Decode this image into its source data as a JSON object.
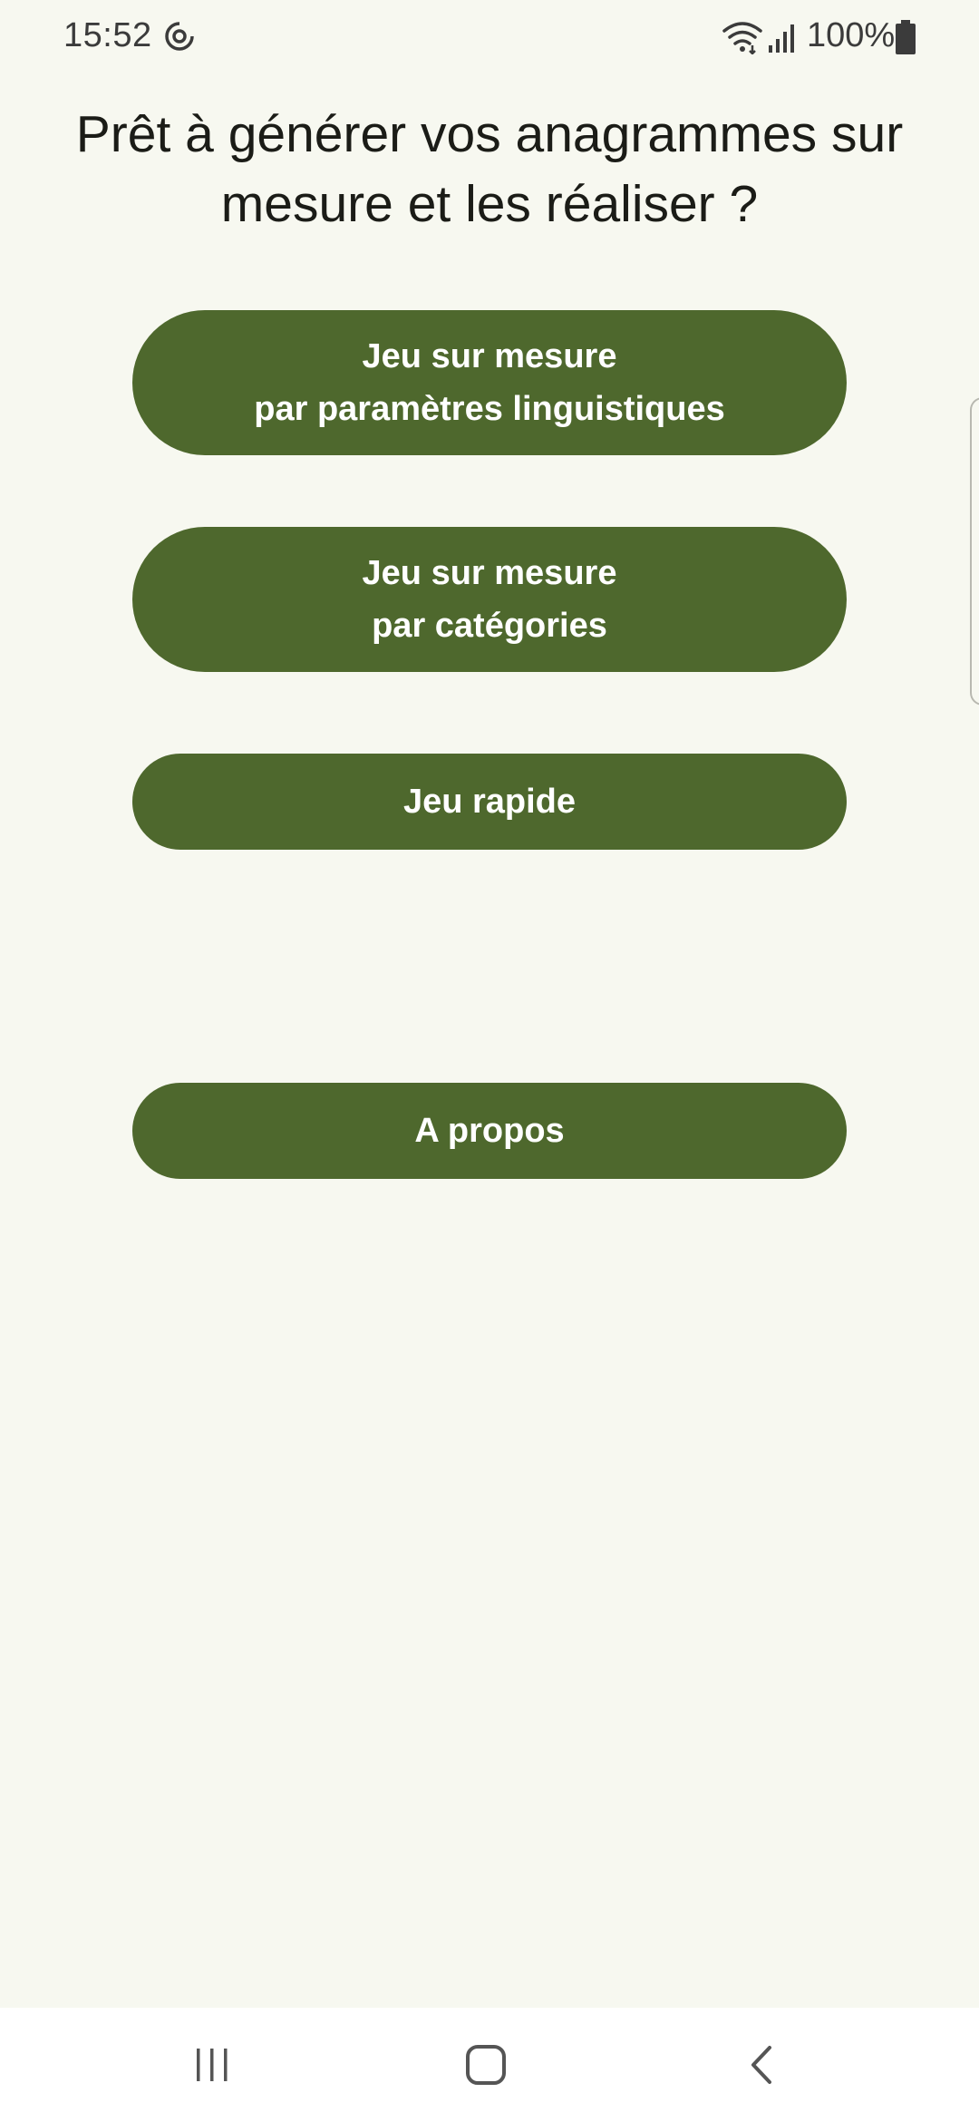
{
  "status_bar": {
    "time": "15:52",
    "battery_percent": "100%",
    "icons": [
      "app-notification-icon",
      "wifi-icon",
      "signal-icon",
      "battery-icon"
    ]
  },
  "main": {
    "headline": "Prêt à générer vos anagrammes sur\nmesure et les réaliser ?",
    "buttons": {
      "linguistic": "Jeu sur mesure\npar paramètres linguistiques",
      "categories": "Jeu sur mesure\npar catégories",
      "quick": "Jeu rapide",
      "about": "A propos"
    }
  },
  "nav_bar": {
    "icons": [
      "recents-icon",
      "home-icon",
      "back-icon"
    ]
  },
  "colors": {
    "background": "#f7f8f0",
    "button": "#4e682d",
    "button_text": "#ffffff",
    "headline_text": "#1b1c17"
  }
}
